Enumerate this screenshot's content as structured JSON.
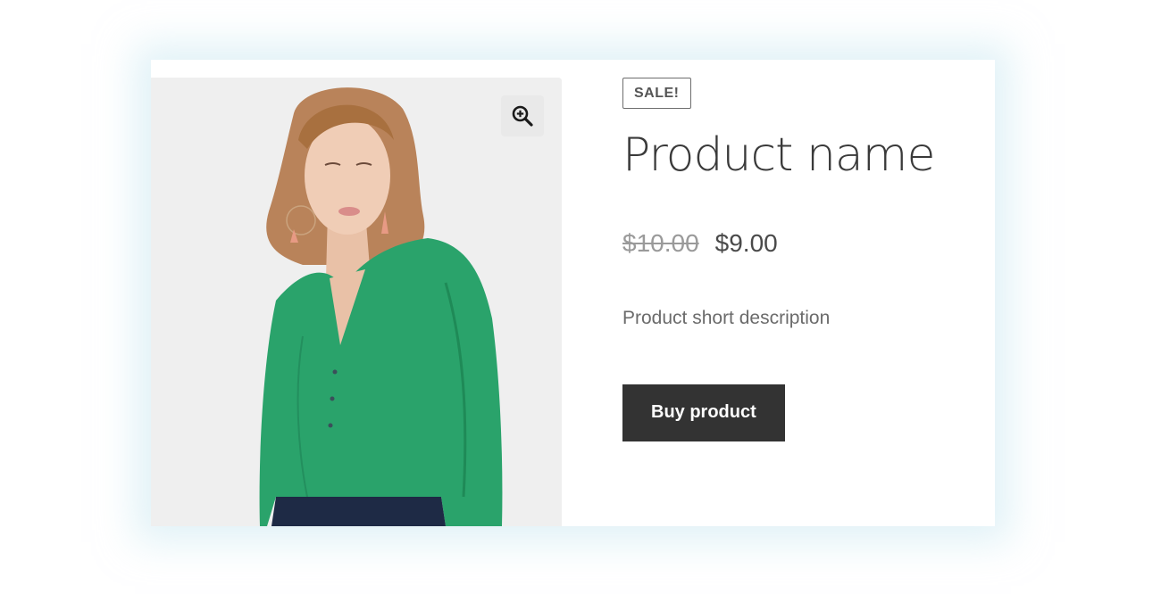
{
  "product": {
    "badge": "SALE!",
    "title": "Product name",
    "price_old": "$10.00",
    "price_new": "$9.00",
    "short_description": "Product short description",
    "buy_label": "Buy product"
  },
  "gallery": {
    "zoom_icon": "zoom-in-icon",
    "image": "product-photo"
  },
  "colors": {
    "shirt": "#2aa36b",
    "button_bg": "#333333",
    "photo_bg": "#efefef"
  }
}
